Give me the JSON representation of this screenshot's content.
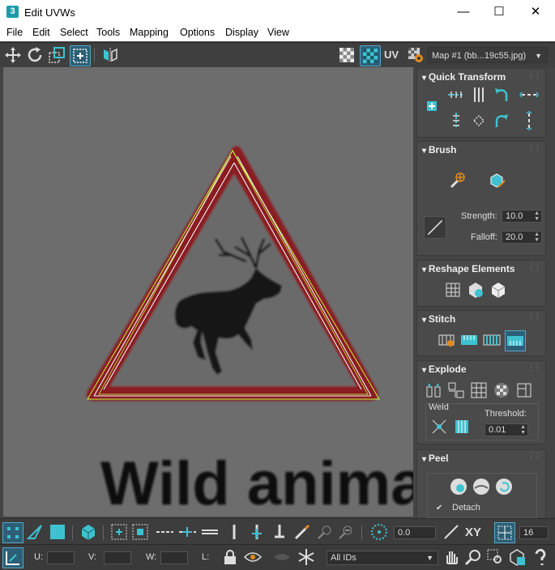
{
  "window": {
    "app_icon": "3",
    "title": "Edit UVWs",
    "minimize": "—",
    "maximize": "☐",
    "close": "✕"
  },
  "menu": [
    "File",
    "Edit",
    "Select",
    "Tools",
    "Mapping",
    "Options",
    "Display",
    "View"
  ],
  "toolbar": {
    "uv_label": "UV",
    "map_select": "Map #1 (bb...19c55.jpg)"
  },
  "viewport": {
    "sign_text": "Wild animal"
  },
  "panels": {
    "quick_transform": "Quick Transform",
    "brush": {
      "title": "Brush",
      "strength_label": "Strength:",
      "strength_value": "10.0",
      "falloff_label": "Falloff:",
      "falloff_value": "20.0"
    },
    "reshape": "Reshape Elements",
    "stitch": "Stitch",
    "explode": {
      "title": "Explode",
      "weld_label": "Weld",
      "threshold_label": "Threshold:",
      "threshold_value": "0.01"
    },
    "peel": {
      "title": "Peel",
      "detach_label": "Detach",
      "detach_checked": true
    }
  },
  "bottom1": {
    "angle_value": "0.0",
    "xy_label": "XY",
    "count_value": "16"
  },
  "bottom2": {
    "u_label": "U:",
    "v_label": "V:",
    "w_label": "W:",
    "l_label": "L:",
    "ids_select": "All IDs"
  },
  "colors": {
    "accent": "#3fc2d0",
    "selected_bg": "#2c5f76",
    "sign_red": "#8a1f24",
    "uv_edge": "#c8f53a"
  }
}
